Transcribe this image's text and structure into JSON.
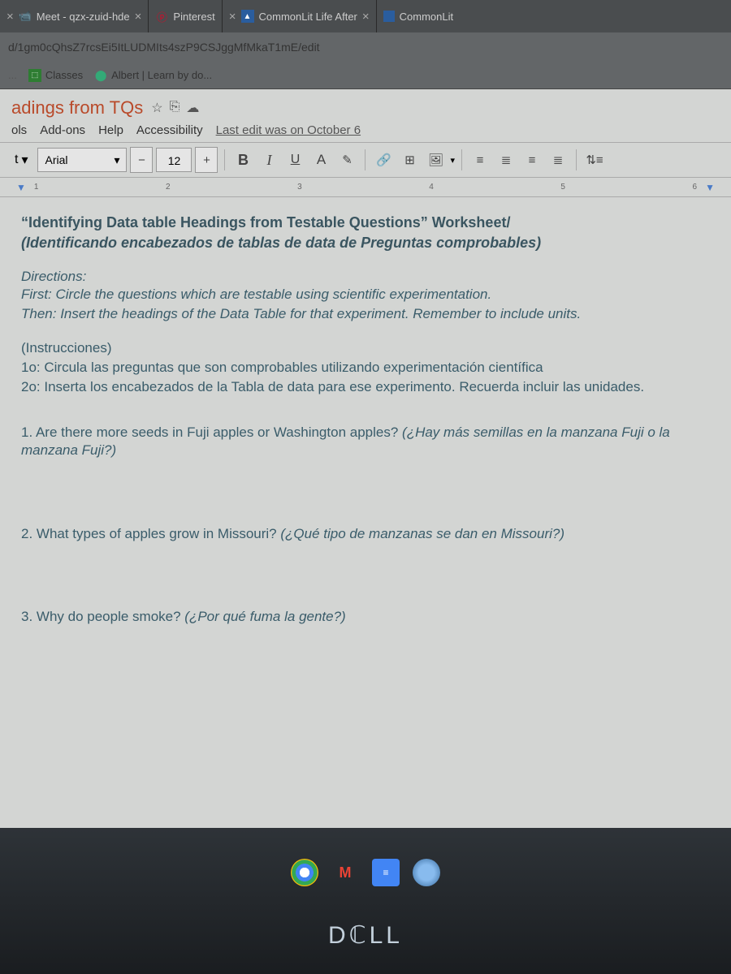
{
  "tabs": [
    {
      "label": "Meet - qzx-zuid-hde",
      "close": "×"
    },
    {
      "label": "Pinterest",
      "close": "×"
    },
    {
      "label": "CommonLit Life After",
      "close": "×"
    },
    {
      "label": "CommonLit",
      "close": ""
    }
  ],
  "url": "d/1gm0cQhsZ7rcsEi5ItLUDMIts4szP9CSJggMfMkaT1mE/edit",
  "bookmarks": [
    {
      "label": "Classes"
    },
    {
      "label": "Albert | Learn by do..."
    }
  ],
  "doc": {
    "title": "adings from TQs",
    "menu": [
      "ols",
      "Add-ons",
      "Help",
      "Accessibility"
    ],
    "edit_info": "Last edit was on October 6",
    "style_label": "t",
    "font_name": "Arial",
    "font_size": "12",
    "ruler_marks": [
      "1",
      "2",
      "3",
      "4",
      "5",
      "6"
    ],
    "heading_en": "“Identifying Data table Headings from Testable Questions” Worksheet/",
    "heading_es": "(Identificando encabezados de tablas de data de Preguntas comprobables)",
    "dir_label": "Directions:",
    "dir_en1": "First:  Circle the questions which are testable using scientific experimentation.",
    "dir_en2": "Then: Insert the headings of the Data Table for that experiment. Remember to include units.",
    "instr_label": "(Instrucciones)",
    "instr_es1": "1o:  Circula las preguntas que son comprobables utilizando experimentación científica",
    "instr_es2": "2o:  Inserta los encabezados de la Tabla de data para ese experimento.  Recuerda incluir las unidades.",
    "q1": "1. Are there more seeds in Fuji apples or Washington apples? ",
    "q1_es": "(¿Hay más semillas en la manzana Fuji o la manzana Fuji?)",
    "q2": "2. What types of apples grow in Missouri? ",
    "q2_es": "(¿Qué tipo de manzanas se dan en Missouri?)",
    "q3": "3. Why do people smoke? ",
    "q3_es": "(¿Por qué fuma la gente?)"
  },
  "dell": "DℂLL"
}
